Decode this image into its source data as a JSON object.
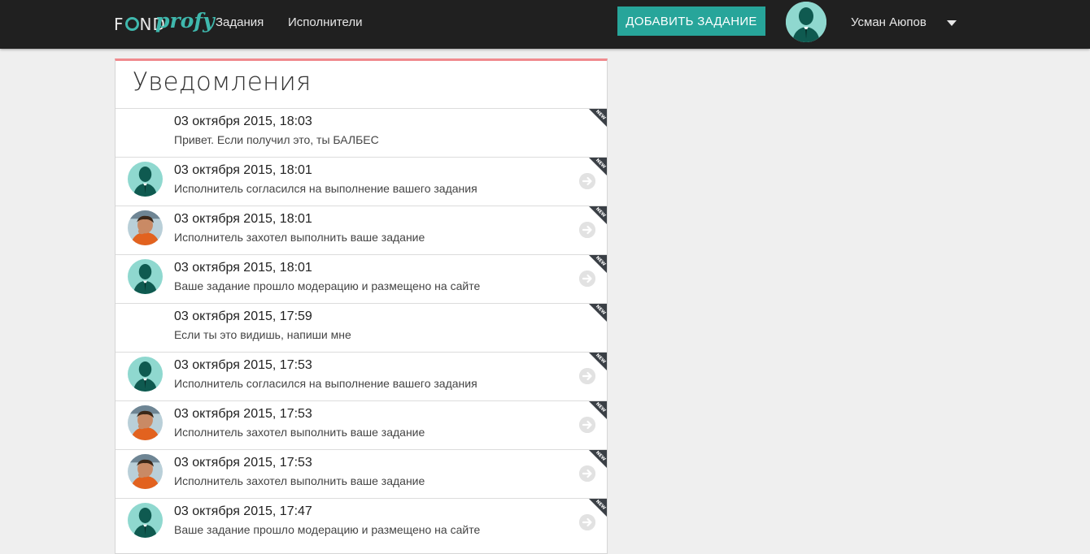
{
  "header": {
    "logo": {
      "part1": "F",
      "part2": "ND",
      "part3": "profy"
    },
    "nav": {
      "tasks": "Задания",
      "executors": "Исполнители"
    },
    "add_task_label": "ДОБАВИТЬ ЗАДАНИЕ",
    "user_name": "Усман Аюпов"
  },
  "page": {
    "title": "Уведомления"
  },
  "badge": {
    "new_label": "NEW"
  },
  "colors": {
    "accent": "#27a59a",
    "panel_top_border": "#f08a8e",
    "topbar": "#202020"
  },
  "notifications": [
    {
      "date": "03 октября 2015, 18:03",
      "text": "Привет. Если получил это, ты БАЛБЕС",
      "avatar": "none",
      "arrow": false,
      "is_new": true
    },
    {
      "date": "03 октября 2015, 18:01",
      "text": "Исполнитель согласился на выполнение вашего задания",
      "avatar": "silhouette",
      "arrow": true,
      "is_new": true
    },
    {
      "date": "03 октября 2015, 18:01",
      "text": "Исполнитель захотел выполнить ваше задание",
      "avatar": "photo",
      "arrow": true,
      "is_new": true
    },
    {
      "date": "03 октября 2015, 18:01",
      "text": "Ваше задание прошло модерацию и размещено на сайте",
      "avatar": "silhouette",
      "arrow": true,
      "is_new": true
    },
    {
      "date": "03 октября 2015, 17:59",
      "text": "Если ты это видишь, напиши мне",
      "avatar": "none",
      "arrow": false,
      "is_new": true
    },
    {
      "date": "03 октября 2015, 17:53",
      "text": "Исполнитель согласился на выполнение вашего задания",
      "avatar": "silhouette",
      "arrow": true,
      "is_new": true
    },
    {
      "date": "03 октября 2015, 17:53",
      "text": "Исполнитель захотел выполнить ваше задание",
      "avatar": "photo",
      "arrow": true,
      "is_new": true
    },
    {
      "date": "03 октября 2015, 17:53",
      "text": "Исполнитель захотел выполнить ваше задание",
      "avatar": "photo",
      "arrow": true,
      "is_new": true
    },
    {
      "date": "03 октября 2015, 17:47",
      "text": "Ваше задание прошло модерацию и размещено на сайте",
      "avatar": "silhouette",
      "arrow": true,
      "is_new": true
    }
  ]
}
